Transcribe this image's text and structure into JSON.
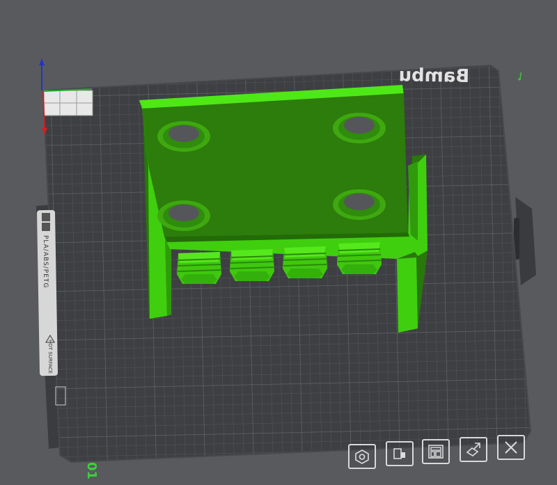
{
  "viewport": {
    "background_color": "#595a5e",
    "bed": {
      "brand_text": "Bambu",
      "plate_label": "PLA/ABS/PETG",
      "warning_label": "HOT SURFACE",
      "plate_number": "01",
      "top_right_mark": "✓",
      "plate_color": "#3e3f43",
      "grid_color": "#57585d"
    },
    "model": {
      "color": "#44d610",
      "dark_color": "#2c7d0b",
      "shadow_color": "#185a04",
      "inserts": 4,
      "holes": 4
    },
    "axes": {
      "z_color": "#2233cc",
      "x_color": "#cc2222",
      "y_color": "#22aa22"
    }
  },
  "toolbar": {
    "buttons": [
      {
        "name": "arrange-icon"
      },
      {
        "name": "orient-icon"
      },
      {
        "name": "layout-icon"
      },
      {
        "name": "auto-orient-icon"
      },
      {
        "name": "delete-icon"
      }
    ]
  }
}
